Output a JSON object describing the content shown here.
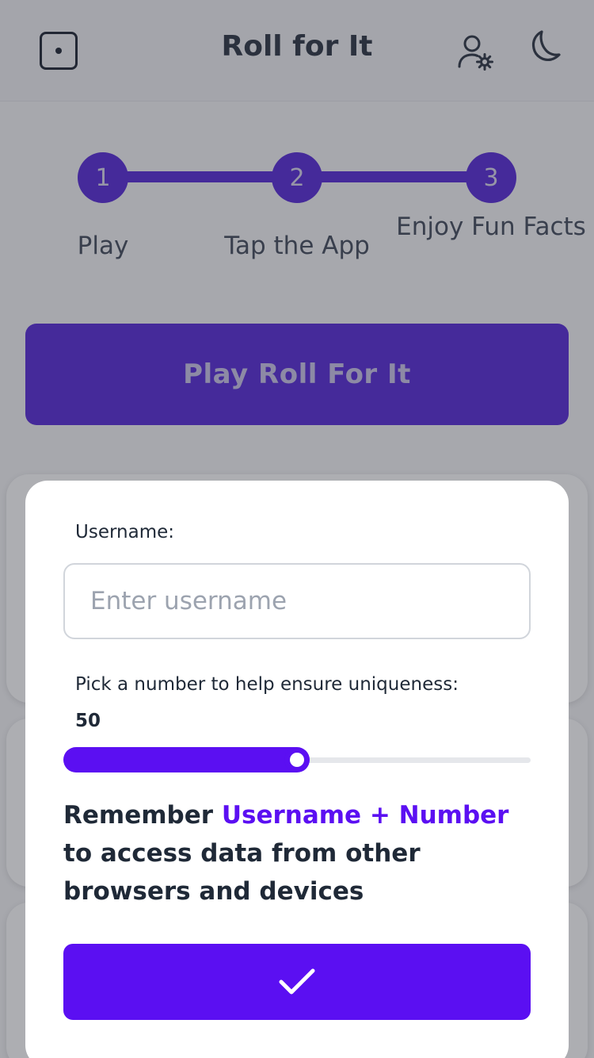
{
  "header": {
    "title": "Roll for It",
    "icons": {
      "logo": "die-icon",
      "account": "user-settings-icon",
      "theme": "moon-icon"
    }
  },
  "steps": [
    {
      "number": "1",
      "label": "Play"
    },
    {
      "number": "2",
      "label": "Tap the App"
    },
    {
      "number": "3",
      "label": "Enjoy Fun Facts"
    }
  ],
  "play_button": {
    "label": "Play Roll For It"
  },
  "modal": {
    "username_label": "Username:",
    "username_placeholder": "Enter username",
    "username_value": "",
    "number_label": "Pick a number to help ensure uniqueness:",
    "number_value": "50",
    "slider": {
      "value": 50,
      "min": 0,
      "max": 100
    },
    "reminder_prefix": "Remember",
    "reminder_highlight": "Username + Number",
    "reminder_suffix": "to access data from other browsers and devices",
    "confirm_icon": "checkmark-icon"
  },
  "colors": {
    "brand_purple": "#4c1dd6",
    "accent_violet": "#5b0ff2"
  }
}
